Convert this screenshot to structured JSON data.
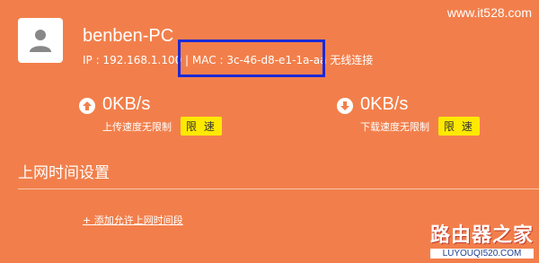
{
  "watermark": "www.it528.com",
  "device": {
    "name": "benben-PC",
    "info": "IP : 192.168.1.100 | MAC : 3c-46-d8-e1-1a-aa    无线连接"
  },
  "upload": {
    "value": "0KB/s",
    "desc": "上传速度无限制",
    "limit_label": "限 速"
  },
  "download": {
    "value": "0KB/s",
    "desc": "下载速度无限制",
    "limit_label": "限 速"
  },
  "section": {
    "title": "上网时间设置",
    "add_link": "+ 添加允许上网时间段"
  },
  "logo": {
    "cn": "路由器之家",
    "en": "LUYOUQI520.COM"
  },
  "colors": {
    "background": "#f27f4b",
    "highlight_box": "#1a2ad8",
    "limit_button": "#ffe900"
  }
}
